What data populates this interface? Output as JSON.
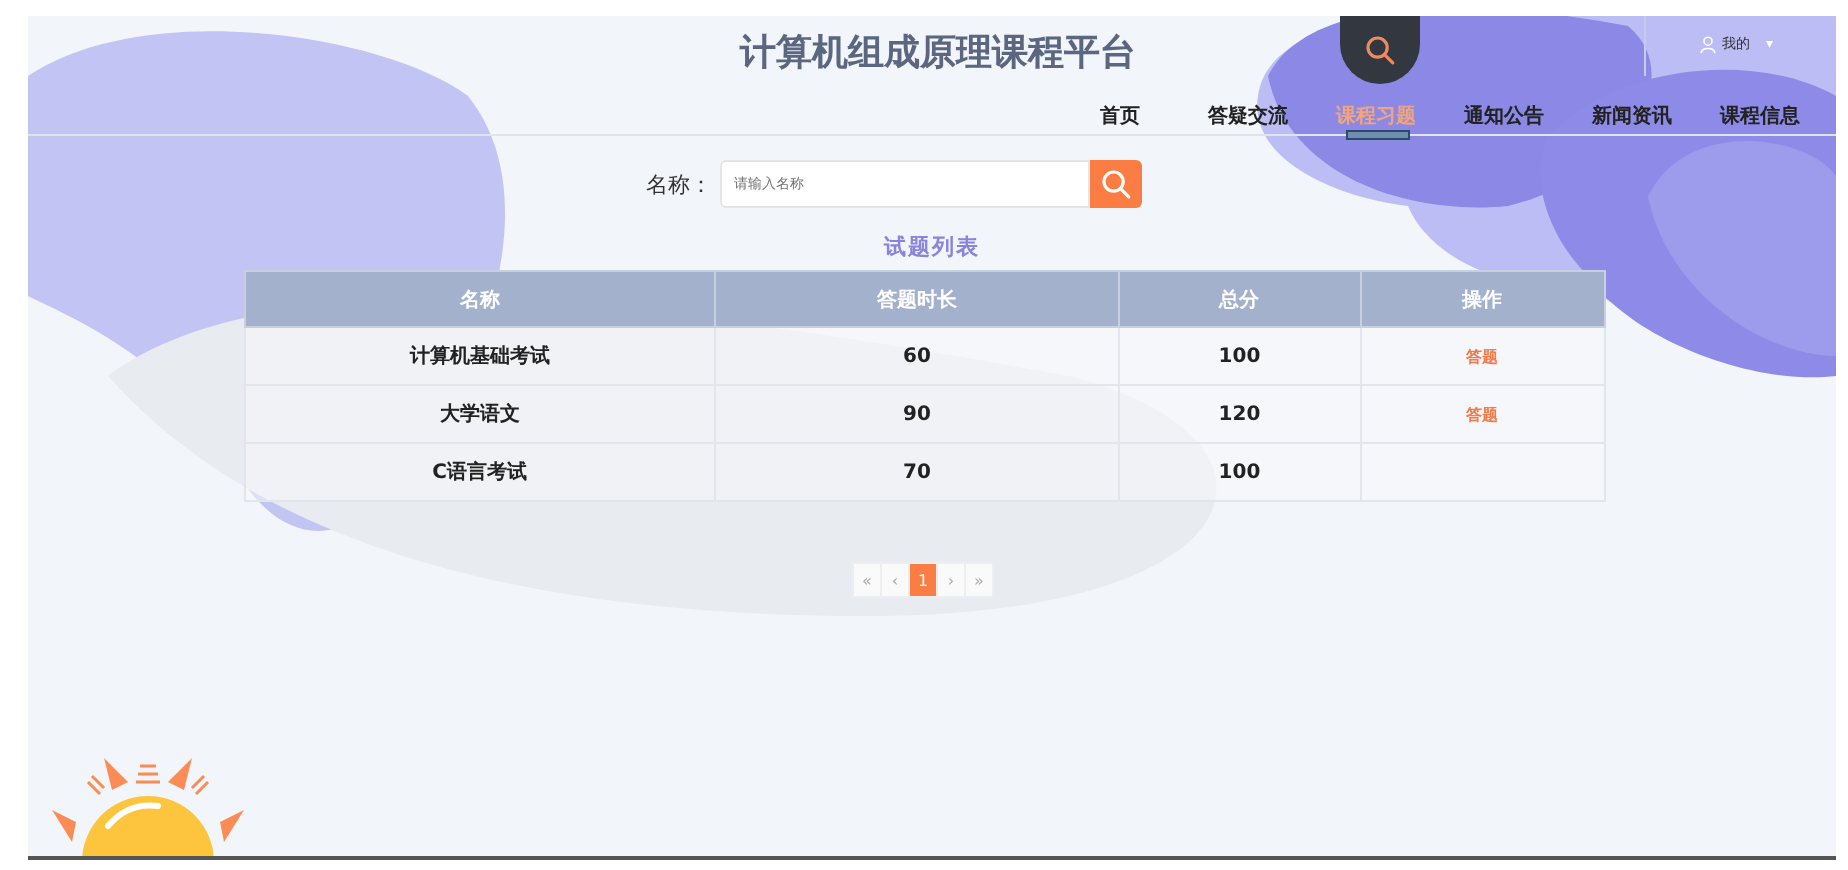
{
  "title": "计算机组成原理课程平台",
  "user": {
    "label": "我的",
    "caret": "▾"
  },
  "nav": [
    {
      "label": "首页",
      "selected": false
    },
    {
      "label": "答疑交流",
      "selected": false
    },
    {
      "label": "课程习题",
      "selected": true
    },
    {
      "label": "通知公告",
      "selected": false
    },
    {
      "label": "新闻资讯",
      "selected": false
    },
    {
      "label": "课程信息",
      "selected": false
    }
  ],
  "search": {
    "label": "名称：",
    "placeholder": "请输入名称"
  },
  "list_title": "试题列表",
  "table": {
    "columns": [
      "名称",
      "答题时长",
      "总分",
      "操作"
    ],
    "rows": [
      {
        "cells": [
          "计算机基础考试",
          "60",
          "100"
        ],
        "action": "答题"
      },
      {
        "cells": [
          "大学语文",
          "90",
          "120"
        ],
        "action": "答题"
      },
      {
        "cells": [
          "C语言考试",
          "70",
          "100"
        ]
      }
    ]
  },
  "pagination": [
    {
      "label": "«",
      "selected": false
    },
    {
      "label": "‹",
      "selected": false
    },
    {
      "label": "1",
      "selected": true
    },
    {
      "label": "›",
      "selected": false
    },
    {
      "label": "»",
      "selected": false
    }
  ]
}
